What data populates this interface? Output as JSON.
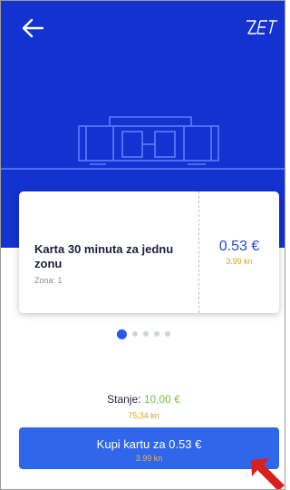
{
  "header": {
    "back_icon": "arrow-left-icon",
    "logo_text": "ZET"
  },
  "ticket": {
    "name": "Karta 30 minuta za jednu zonu",
    "zone": "Zona: 1",
    "price_eur": "0.53 €",
    "price_kn": "3.99 kn"
  },
  "pager": {
    "count": 5,
    "active": 1
  },
  "balance": {
    "label": "Stanje: ",
    "value": "10,00 €",
    "kn": "75,34 kn"
  },
  "buy_button": {
    "label": "Kupi kartu za 0.53 €",
    "kn": "3.99 kn"
  },
  "colors": {
    "hero": "#1432d0",
    "accent": "#2f66ea",
    "price": "#2347d6",
    "kuna": "#e0a01a",
    "balance": "#7bc043",
    "pointer": "#d9201c"
  }
}
